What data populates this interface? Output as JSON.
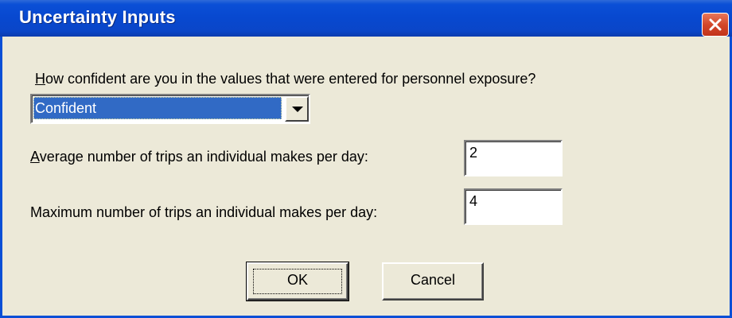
{
  "window": {
    "title": "Uncertainty Inputs",
    "close_icon": "close-icon"
  },
  "question": {
    "prefix": "H",
    "rest": "ow confident are you in the values that were entered for personnel exposure?"
  },
  "confidence": {
    "selected": "Confident"
  },
  "avg_trips": {
    "label_prefix": "A",
    "label_rest": "verage number of trips an individual makes per day:",
    "value": "2"
  },
  "max_trips": {
    "label": "Maximum number of trips an individual makes per day:",
    "value": "4"
  },
  "buttons": {
    "ok": "OK",
    "cancel": "Cancel"
  },
  "colors": {
    "titlebar": "#0a4fd6",
    "dialog_bg": "#ece9d8",
    "selection": "#316ac5",
    "close_button": "#d3472a"
  }
}
